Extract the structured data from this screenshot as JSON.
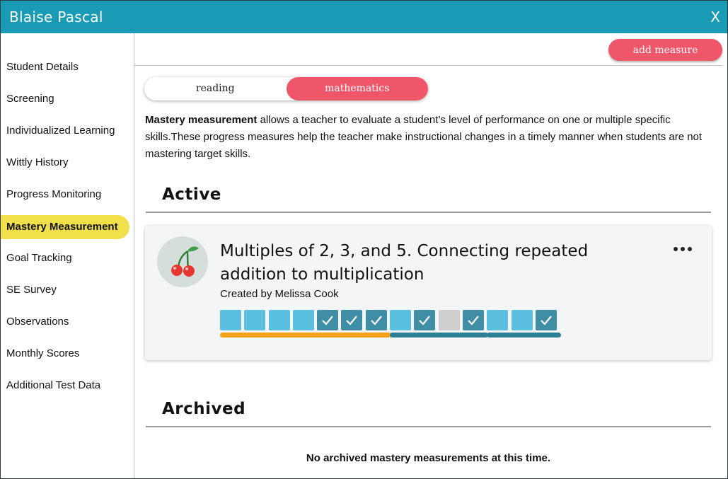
{
  "window": {
    "title": "Blaise Pascal",
    "close_label": "X"
  },
  "sidebar": {
    "items": [
      {
        "label": "Student Details"
      },
      {
        "label": "Screening"
      },
      {
        "label": "Individualized Learning"
      },
      {
        "label": "Wittly History"
      },
      {
        "label": "Progress Monitoring"
      },
      {
        "label": "Mastery Measurement",
        "active": true
      },
      {
        "label": "Goal Tracking"
      },
      {
        "label": "SE Survey"
      },
      {
        "label": "Observations"
      },
      {
        "label": "Monthly Scores"
      },
      {
        "label": "Additional Test Data"
      }
    ]
  },
  "toolbar": {
    "add_label": "add measure"
  },
  "subject_toggle": {
    "reading": "reading",
    "mathematics": "mathematics",
    "selected": "mathematics"
  },
  "description": {
    "bold": "Mastery measurement",
    "text": " allows a teacher to evaluate a student’s level of performance on one or multiple specific skills.These progress measures help the teacher make instructional changes in a timely manner when students are not mastering target skills."
  },
  "active": {
    "heading": "Active",
    "cards": [
      {
        "icon": "cherry-icon",
        "title": "Multiples of 2, 3, and 5. Connecting repeated addition to multiplication",
        "author": "Created by Melissa Cook",
        "more_icon": "more-icon",
        "blocks": [
          {
            "state": "light",
            "checked": false
          },
          {
            "state": "light",
            "checked": false
          },
          {
            "state": "light",
            "checked": false
          },
          {
            "state": "light",
            "checked": false
          },
          {
            "state": "dark",
            "checked": true
          },
          {
            "state": "dark",
            "checked": true
          },
          {
            "state": "dark",
            "checked": true
          },
          {
            "state": "light",
            "checked": false
          },
          {
            "state": "dark",
            "checked": true
          },
          {
            "state": "gray",
            "checked": false
          },
          {
            "state": "dark",
            "checked": true
          },
          {
            "state": "light",
            "checked": false
          },
          {
            "state": "light",
            "checked": false
          },
          {
            "state": "dark",
            "checked": true
          }
        ],
        "groups": [
          {
            "start": 0,
            "count": 7,
            "color": "#f5a11a"
          },
          {
            "start": 7,
            "count": 4,
            "color": "#2e7f96"
          },
          {
            "start": 11,
            "count": 3,
            "color": "#2e7f96"
          }
        ]
      }
    ]
  },
  "archived": {
    "heading": "Archived",
    "empty_text": "No archived mastery measurements at this time."
  },
  "colors": {
    "header": "#1a9bb5",
    "accent": "#f0566a",
    "active_nav": "#f2e04a",
    "block_light": "#5bbfdf",
    "block_dark": "#3f8ea6",
    "block_gray": "#cfcfcf"
  }
}
